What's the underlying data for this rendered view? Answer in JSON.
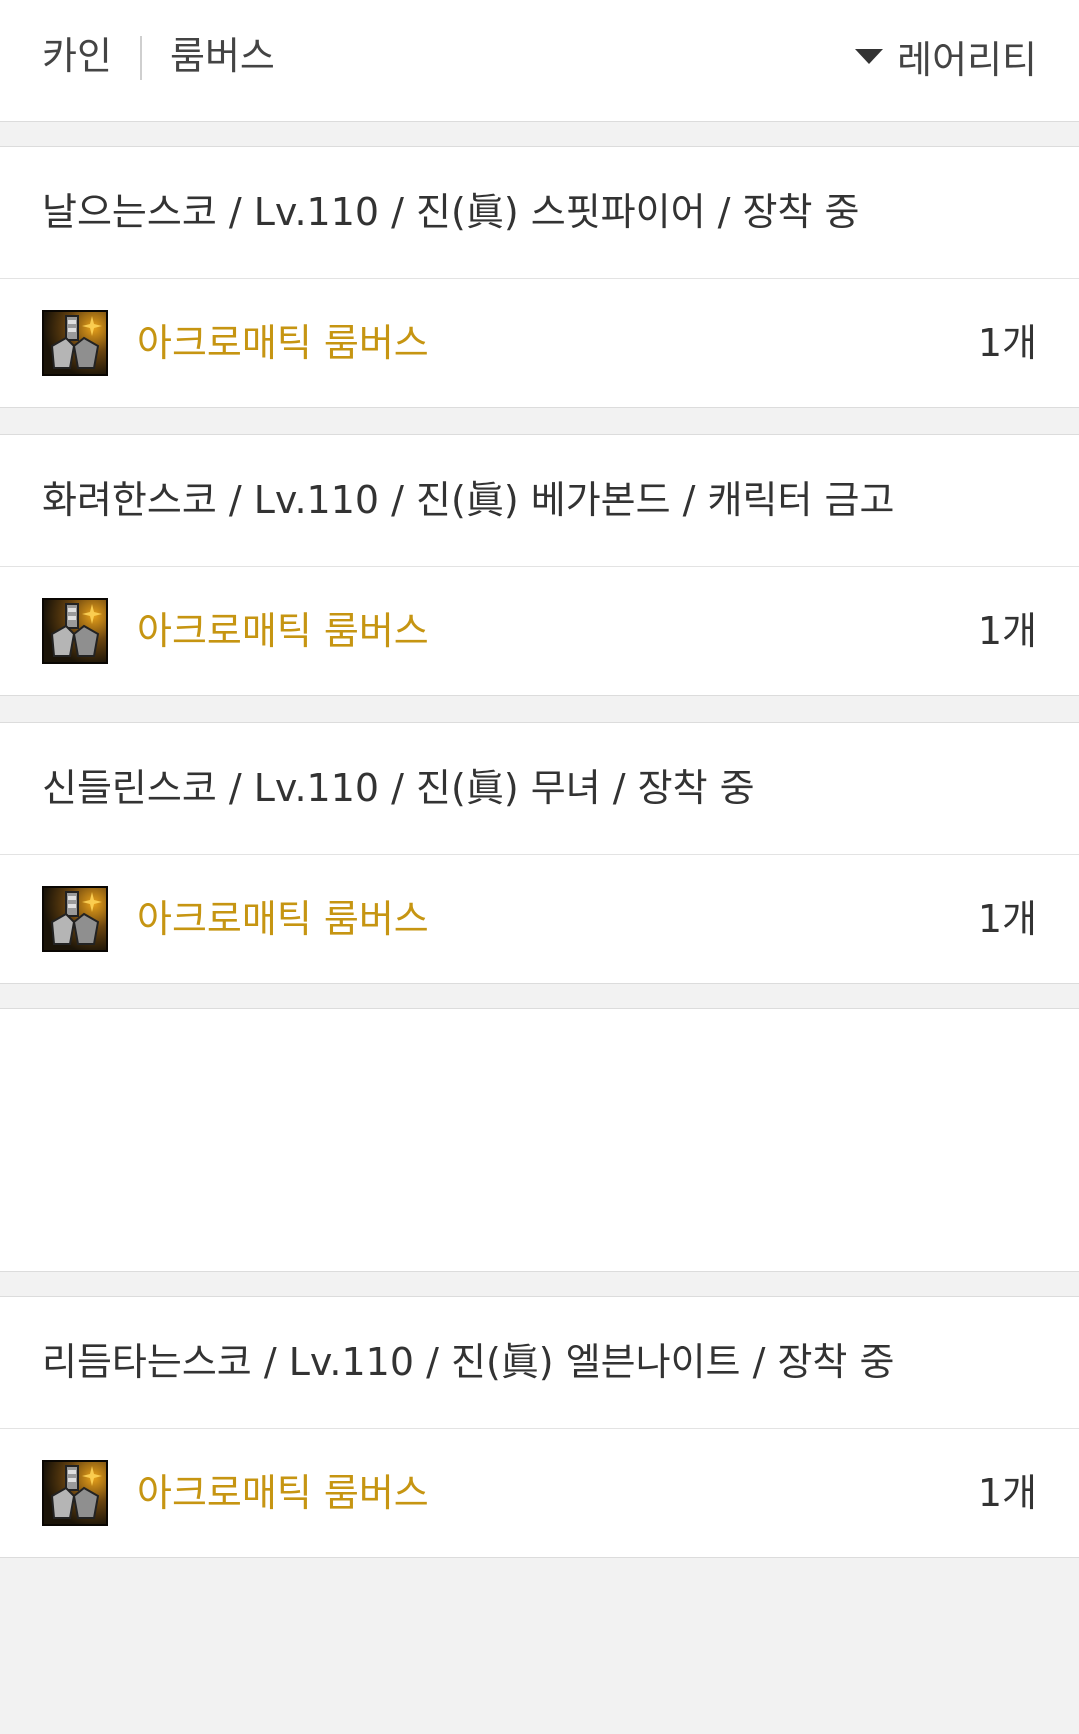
{
  "header": {
    "server": "카인",
    "item": "룸버스",
    "sort_label": "레어리티"
  },
  "entries": [
    {
      "character": "날으는스코 / Lv.110 / 진(眞) 스핏파이어 / 장착 중",
      "item_name": "아크로매틱 룸버스",
      "count": "1개"
    },
    {
      "character": "화려한스코 / Lv.110 / 진(眞) 베가본드 / 캐릭터 금고",
      "item_name": "아크로매틱 룸버스",
      "count": "1개"
    },
    {
      "character": "신들린스코 / Lv.110 / 진(眞) 무녀 / 장착 중",
      "item_name": "아크로매틱 룸버스",
      "count": "1개"
    },
    {
      "character": "리듬타는스코 / Lv.110 / 진(眞) 엘븐나이트 / 장착 중",
      "item_name": "아크로매틱 룸버스",
      "count": "1개"
    }
  ],
  "colors": {
    "item_rarity": "#c69512",
    "background": "#f2f2f2"
  },
  "icons": {
    "sort": "caret-down-icon",
    "item": "waist-armor-item-icon"
  }
}
